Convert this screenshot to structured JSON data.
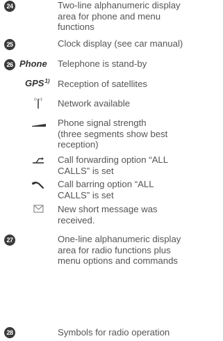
{
  "entries": [
    {
      "number": "24",
      "keyword": "",
      "keyword_sup": "",
      "symbol": "",
      "lines": [
        "Two-line alphanumeric display",
        "area for phone and menu",
        "functions"
      ]
    },
    {
      "number": "25",
      "keyword": "",
      "keyword_sup": "",
      "symbol": "",
      "lines": [
        "Clock display (see car manual)"
      ]
    },
    {
      "number": "26",
      "keyword": "Phone",
      "keyword_sup": "",
      "symbol": "",
      "lines": [
        "Telephone is stand-by"
      ]
    },
    {
      "number": "",
      "keyword": "GPS",
      "keyword_sup": "1)",
      "symbol": "",
      "lines": [
        "Reception of satellites"
      ]
    },
    {
      "number": "",
      "keyword": "",
      "keyword_sup": "",
      "symbol": "antenna-icon",
      "lines": [
        "Network available"
      ]
    },
    {
      "number": "",
      "keyword": "",
      "keyword_sup": "",
      "symbol": "signal-strength-icon",
      "lines": [
        "Phone signal strength",
        "(three segments show best",
        "reception)"
      ]
    },
    {
      "number": "",
      "keyword": "",
      "keyword_sup": "",
      "symbol": "call-forwarding-icon",
      "lines": [
        "Call forwarding option “ALL",
        "CALLS” is set"
      ]
    },
    {
      "number": "",
      "keyword": "",
      "keyword_sup": "",
      "symbol": "call-barring-icon",
      "lines": [
        "Call barring option “ALL",
        "CALLS” is set"
      ]
    },
    {
      "number": "",
      "keyword": "",
      "keyword_sup": "",
      "symbol": "envelope-icon",
      "lines": [
        "New short message was",
        "received."
      ]
    },
    {
      "number": "27",
      "keyword": "",
      "keyword_sup": "",
      "symbol": "",
      "lines": [
        "One-line alphanumeric display",
        "area for radio functions plus",
        "menu options and commands"
      ]
    },
    {
      "number": "28",
      "keyword": "",
      "keyword_sup": "",
      "symbol": "",
      "lines": [
        "Symbols for radio operation"
      ]
    }
  ]
}
